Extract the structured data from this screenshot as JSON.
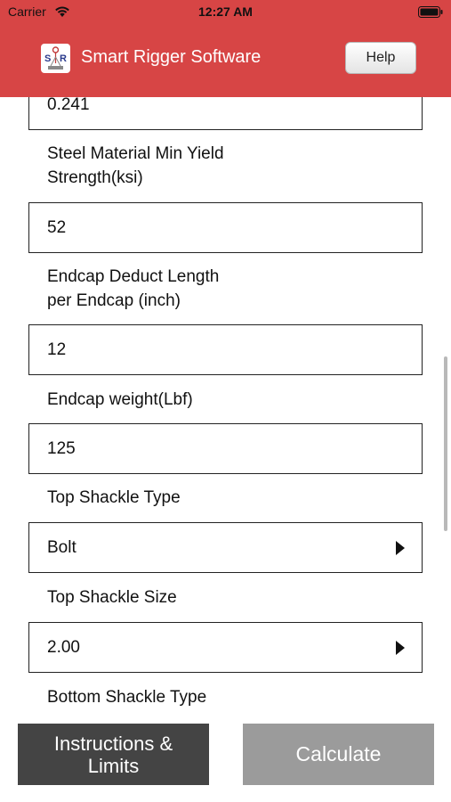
{
  "status_bar": {
    "carrier": "Carrier",
    "time": "12:27 AM"
  },
  "header": {
    "app_title": "Smart Rigger Software",
    "help_label": "Help",
    "bar_color": "#d74545"
  },
  "form": {
    "fields": [
      {
        "value": "0.241"
      },
      {
        "label": "Steel Material Min Yield\nStrength(ksi)",
        "value": "52"
      },
      {
        "label": "Endcap Deduct Length\nper Endcap (inch)",
        "value": "12"
      },
      {
        "label": "Endcap weight(Lbf)",
        "value": "125"
      },
      {
        "label": "Top Shackle Type",
        "value": "Bolt",
        "type": "select"
      },
      {
        "label": "Top Shackle Size",
        "value": "2.00",
        "type": "select"
      },
      {
        "label": "Bottom Shackle Type"
      }
    ]
  },
  "footer": {
    "instructions_label": "Instructions & Limits",
    "calculate_label": "Calculate"
  }
}
